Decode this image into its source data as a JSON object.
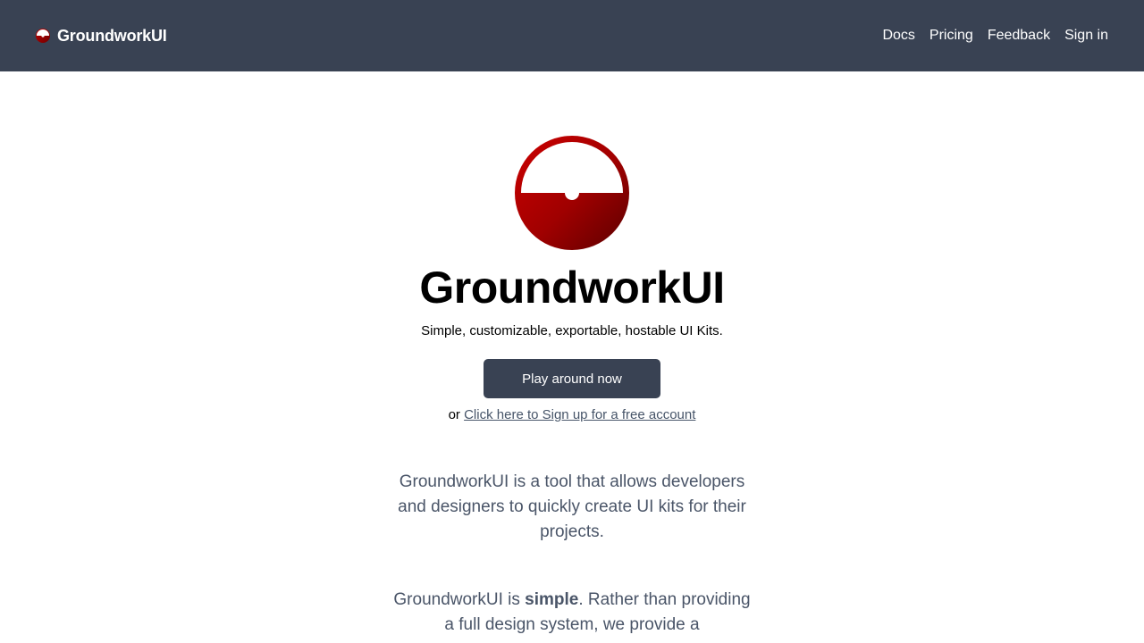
{
  "navbar": {
    "brand": "GroundworkUI",
    "links": {
      "docs": "Docs",
      "pricing": "Pricing",
      "feedback": "Feedback",
      "signin": "Sign in"
    }
  },
  "hero": {
    "title": "GroundworkUI",
    "subtitle": "Simple, customizable, exportable, hostable UI Kits.",
    "cta_label": "Play around now",
    "signup_prefix": "or",
    "signup_link": "Click here to Sign up for a free account"
  },
  "body": {
    "para1": "GroundworkUI is a tool that allows developers and designers to quickly create UI kits for their projects.",
    "para2_start": "GroundworkUI is",
    "para2_bold": "simple",
    "para2_rest": ". Rather than providing a full design system, we provide a"
  },
  "colors": {
    "navbar_bg": "#394253",
    "button_bg": "#394253",
    "logo_red": "#b00000",
    "logo_dark_red": "#7a0000"
  },
  "icons": {
    "logo": "groundwork-logo-icon"
  }
}
